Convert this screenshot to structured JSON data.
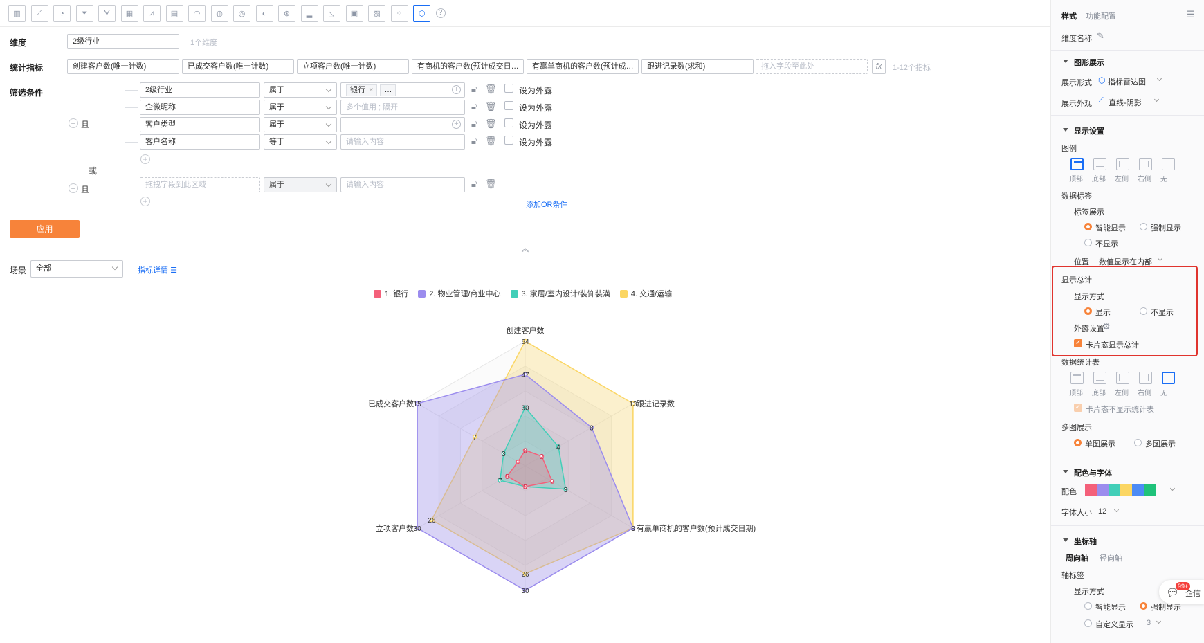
{
  "toolbar": {
    "icons": [
      "bar-chart-icon",
      "line-chart-icon",
      "pie-chart-icon",
      "funnel-icon",
      "funnel-alt-icon",
      "table-icon",
      "combo-chart-icon",
      "card-icon",
      "gauge-icon",
      "map-icon",
      "geo-map-icon",
      "globe-map-icon",
      "scatter-map-icon",
      "histogram-icon",
      "area-chart-icon",
      "image-grid-icon",
      "pivot-table-icon",
      "dot-plot-icon",
      "radar-chart-icon",
      "help-icon"
    ],
    "selected": "radar-chart-icon"
  },
  "config": {
    "dimension_label": "维度",
    "dimension_value": "2级行业",
    "dimension_hint": "1个维度",
    "metrics_label": "统计指标",
    "metrics": [
      "创建客户数(唯一计数)",
      "已成交客户数(唯一计数)",
      "立项客户数(唯一计数)",
      "有商机的客户数(预计成交日…",
      "有赢单商机的客户数(预计成…",
      "跟进记录数(求和)"
    ],
    "metrics_drop": "拖入字段至此处",
    "metrics_fx": "fx",
    "metrics_hint": "1-12个指标",
    "filter_label": "筛选条件",
    "and": "且",
    "or": "或",
    "rows": [
      {
        "field": "2级行业",
        "op": "属于",
        "value": "银行",
        "extra": "…",
        "expose": "设为外露"
      },
      {
        "field": "企微昵称",
        "op": "属于",
        "placeholder": "多个值用 ; 隔开",
        "expose": "设为外露"
      },
      {
        "field": "客户类型",
        "op": "属于",
        "expose": "设为外露"
      },
      {
        "field": "客户名称",
        "op": "等于",
        "placeholder": "请输入内容",
        "expose": "设为外露"
      }
    ],
    "row5": {
      "field_placeholder": "拖拽字段到此区域",
      "op": "属于",
      "placeholder": "请输入内容"
    },
    "add_or": "添加OR条件",
    "apply": "应用"
  },
  "scene": {
    "label": "场景",
    "value": "全部",
    "detail_link": "指标详情"
  },
  "chart_data": {
    "type": "radar",
    "indicators": [
      "创建客户数",
      "跟进记录数",
      "有赢单商机的客户数(预计成交日期)",
      "有商机的客户数(预计成交日期)",
      "立项客户数",
      "已成交客户数"
    ],
    "series": [
      {
        "name": "1. 银行",
        "color": "#f4607a",
        "values": [
          8,
          2,
          2,
          5,
          5,
          1
        ]
      },
      {
        "name": "2. 物业管理/商业中心",
        "color": "#9b8cee",
        "values": [
          47,
          8,
          8,
          30,
          30,
          15
        ]
      },
      {
        "name": "3. 家居/室内设计/装饰装潢",
        "color": "#42cfb8",
        "values": [
          30,
          4,
          3,
          5,
          7,
          3
        ]
      },
      {
        "name": "4. 交通/运输",
        "color": "#fbd663",
        "values": [
          64,
          13,
          8,
          26,
          26,
          7
        ]
      }
    ],
    "max": [
      64,
      13,
      8,
      30,
      30,
      15
    ],
    "value_labels": [
      [
        "8",
        "2",
        "2",
        "5",
        "5",
        "1"
      ],
      [
        "47",
        "8",
        "8",
        "30",
        "30",
        "15"
      ],
      [
        "30",
        "4",
        "3",
        "5",
        "7",
        "3"
      ],
      [
        "64",
        "13",
        "8",
        "26",
        "26",
        "7"
      ]
    ]
  },
  "panel": {
    "tabs": [
      "样式",
      "功能配置"
    ],
    "dim_name": "维度名称",
    "s_graph": "图形展示",
    "display_form_label": "展示形式",
    "display_form": "指标雷达图",
    "display_look_label": "展示外观",
    "display_look": "直线-阴影",
    "s_display": "显示设置",
    "legend_label": "图例",
    "positions": [
      "顶部",
      "底部",
      "左侧",
      "右侧",
      "无"
    ],
    "data_label": "数据标签",
    "label_show": "标签展示",
    "smart": "智能显示",
    "force": "强制显示",
    "hide": "不显示",
    "position_label": "位置",
    "position_value": "数值显示在内部",
    "total_label": "显示总计",
    "total_mode": "显示方式",
    "show": "显示",
    "noshow": "不显示",
    "expose_setting": "外露设置",
    "card_total": "卡片态显示总计",
    "stat_table": "数据统计表",
    "card_no_stat": "卡片态不显示统计表",
    "multi": "多图展示",
    "single": "单图展示",
    "multiple": "多图展示",
    "s_color": "配色与字体",
    "color_label": "配色",
    "palette": [
      "#f4607a",
      "#9b8cee",
      "#42cfb8",
      "#fbd663",
      "#4c8bf5",
      "#1fc27a"
    ],
    "font_size_label": "字体大小",
    "font_size": "12",
    "s_axis": "坐标轴",
    "axis_tabs": [
      "周向轴",
      "径向轴"
    ],
    "axis_label": "轴标签",
    "axis_mode": "显示方式",
    "custom": "自定义显示",
    "custom_val": "3",
    "chat_badge": "99+",
    "chat_label": "企信"
  }
}
